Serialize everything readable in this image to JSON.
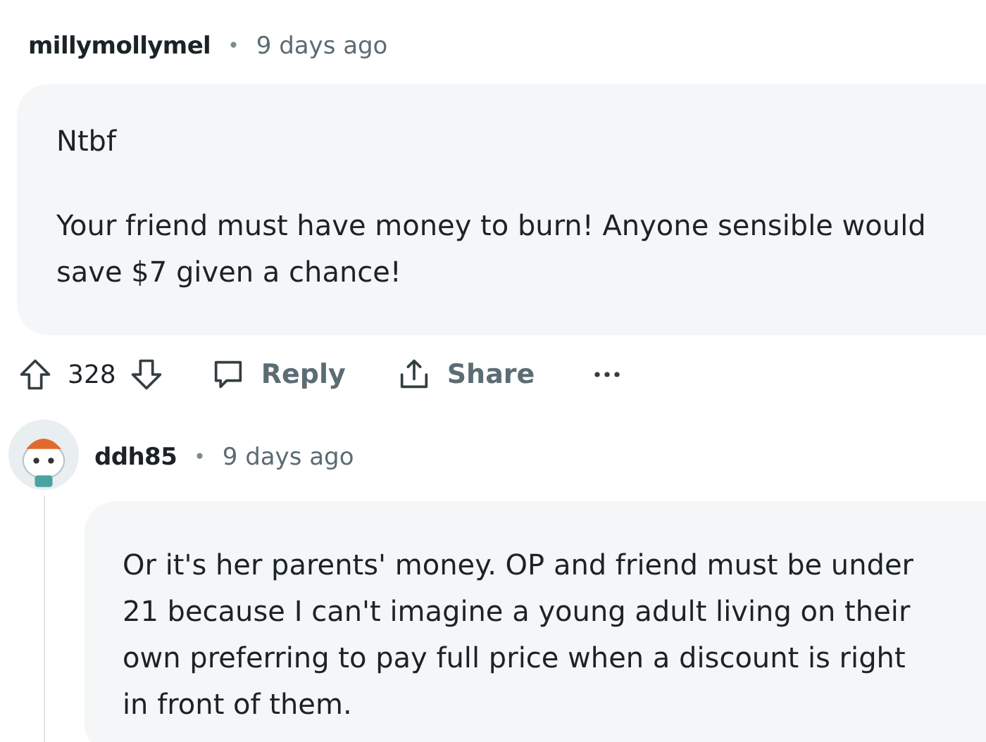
{
  "comments": [
    {
      "kind": "root",
      "author": "millymollymel",
      "separator": "•",
      "time": "9 days ago",
      "paragraphs": [
        "Ntbf",
        "Your friend must have money to burn! Anyone sensible would save $7 given a chance!"
      ],
      "actions": {
        "score": "328",
        "reply": "Reply",
        "share": "Share"
      }
    },
    {
      "kind": "nested",
      "author": "ddh85",
      "separator": "•",
      "time": "9 days ago",
      "paragraphs": [
        "Or it's her parents' money. OP and friend must be under 21 because I can't imagine a young adult living on their own preferring to pay full price when a discount is right in front of them."
      ]
    }
  ]
}
